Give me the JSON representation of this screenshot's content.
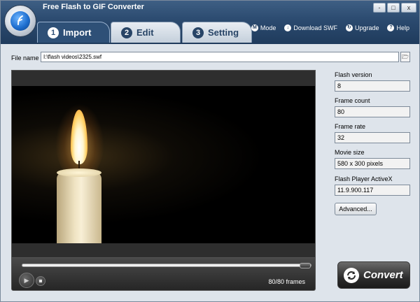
{
  "window": {
    "title": "Free Flash to GIF Converter",
    "minimize_label": "-",
    "maximize_label": "□",
    "close_label": "x"
  },
  "tabs": [
    {
      "number": "1",
      "label": "Import",
      "active": true
    },
    {
      "number": "2",
      "label": "Edit",
      "active": false
    },
    {
      "number": "3",
      "label": "Setting",
      "active": false
    }
  ],
  "topmenu": [
    {
      "label": "Mode",
      "icon": "mode-icon"
    },
    {
      "label": "Download SWF",
      "icon": "download-icon"
    },
    {
      "label": "Upgrade",
      "icon": "upgrade-icon"
    },
    {
      "label": "Help",
      "icon": "help-icon"
    }
  ],
  "file": {
    "label": "File name",
    "value": "I:\\flash videos\\2325.swf",
    "browse_icon": "folder-icon"
  },
  "player": {
    "progress_fraction": 1.0,
    "frames_text": "80/80 frames",
    "play_glyph": "▶"
  },
  "info": {
    "flash_version": {
      "label": "Flash version",
      "value": "8"
    },
    "frame_count": {
      "label": "Frame count",
      "value": "80"
    },
    "frame_rate": {
      "label": "Frame rate",
      "value": "32"
    },
    "movie_size": {
      "label": "Movie size",
      "value": "580 x 300 pixels"
    },
    "activex": {
      "label": "Flash Player ActiveX",
      "value": "11.9.900.117"
    }
  },
  "buttons": {
    "advanced": "Advanced...",
    "convert": "Convert"
  }
}
